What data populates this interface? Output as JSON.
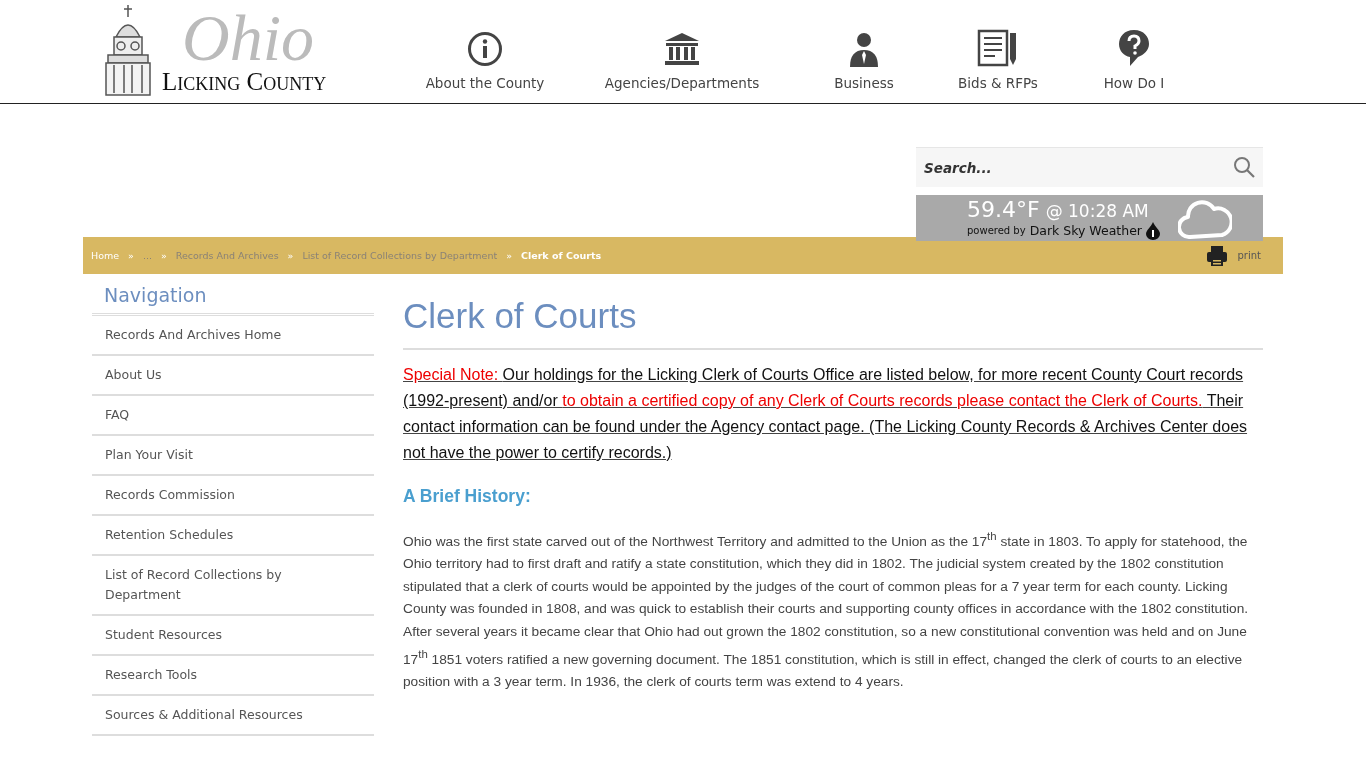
{
  "logo": {
    "script": "Ohio",
    "name": "Licking County"
  },
  "top_nav": [
    {
      "label": "About the County"
    },
    {
      "label": "Agencies/Departments"
    },
    {
      "label": "Business"
    },
    {
      "label": "Bids & RFPs"
    },
    {
      "label": "How Do I"
    }
  ],
  "search": {
    "placeholder": "Search..."
  },
  "weather": {
    "temperature": "59.4°F",
    "time": "@ 10:28 AM",
    "powered_prefix": "powered by",
    "powered_name": "Dark Sky Weather"
  },
  "breadcrumb": [
    {
      "label": "Home",
      "current": false,
      "muted": false
    },
    {
      "label": "...",
      "current": false,
      "muted": true
    },
    {
      "label": "Records And Archives",
      "current": false,
      "muted": true
    },
    {
      "label": "List of Record Collections by Department",
      "current": false,
      "muted": true
    },
    {
      "label": "Clerk of Courts",
      "current": true,
      "muted": false
    }
  ],
  "breadcrumb_separator": "»",
  "print": {
    "label": "print"
  },
  "sidebar": {
    "title": "Navigation",
    "items": [
      "Records And Archives Home",
      "About Us",
      "FAQ",
      "Plan Your Visit",
      "Records Commission",
      "Retention Schedules",
      "List of Record Collections by Department",
      "Student Resources",
      "Research Tools",
      "Sources & Additional Resources"
    ]
  },
  "page_title": "Clerk of Courts",
  "special_note": [
    {
      "text": " Special Note: ",
      "kind": "highlight"
    },
    {
      "text": "Our holdings for the Licking Clerk of Courts Office are listed below, for more recent County Court records (1992-present) and/or ",
      "kind": "plain"
    },
    {
      "text": "to obtain a certified copy of any Clerk of Courts records please contact the Clerk of Courts.",
      "kind": "highlight"
    },
    {
      "text": " Their contact information can be found under the Agency contact page. (The Licking County Records & Archives Center does not have the power to certify records.)",
      "kind": "plain"
    }
  ],
  "section_heading": "A Brief History:",
  "history": "Ohio was the first state carved out of the Northwest Territory and admitted to the Union as the 17$^{th}$ state in 1803. To apply for statehood, the Ohio territory had to first draft and ratify a state constitution, which they did in 1802. The judicial system created by the 1802 constitution stipulated that a clerk of courts would be appointed by the judges of the court of common pleas for a 7 year term for each county. Licking County was founded in 1808, and was quick to establish their courts and supporting county offices in accordance with the 1802 constitution. After several years it became clear that Ohio had out grown the 1802 constitution, so a new constitutional convention was held and on June 17$^{th}$ 1851 voters ratified a new governing document. The 1851 constitution, which is still in effect, changed the clerk of courts to an elective position with a 3 year term. In 1936, the clerk of courts term was extend to 4 years."
}
